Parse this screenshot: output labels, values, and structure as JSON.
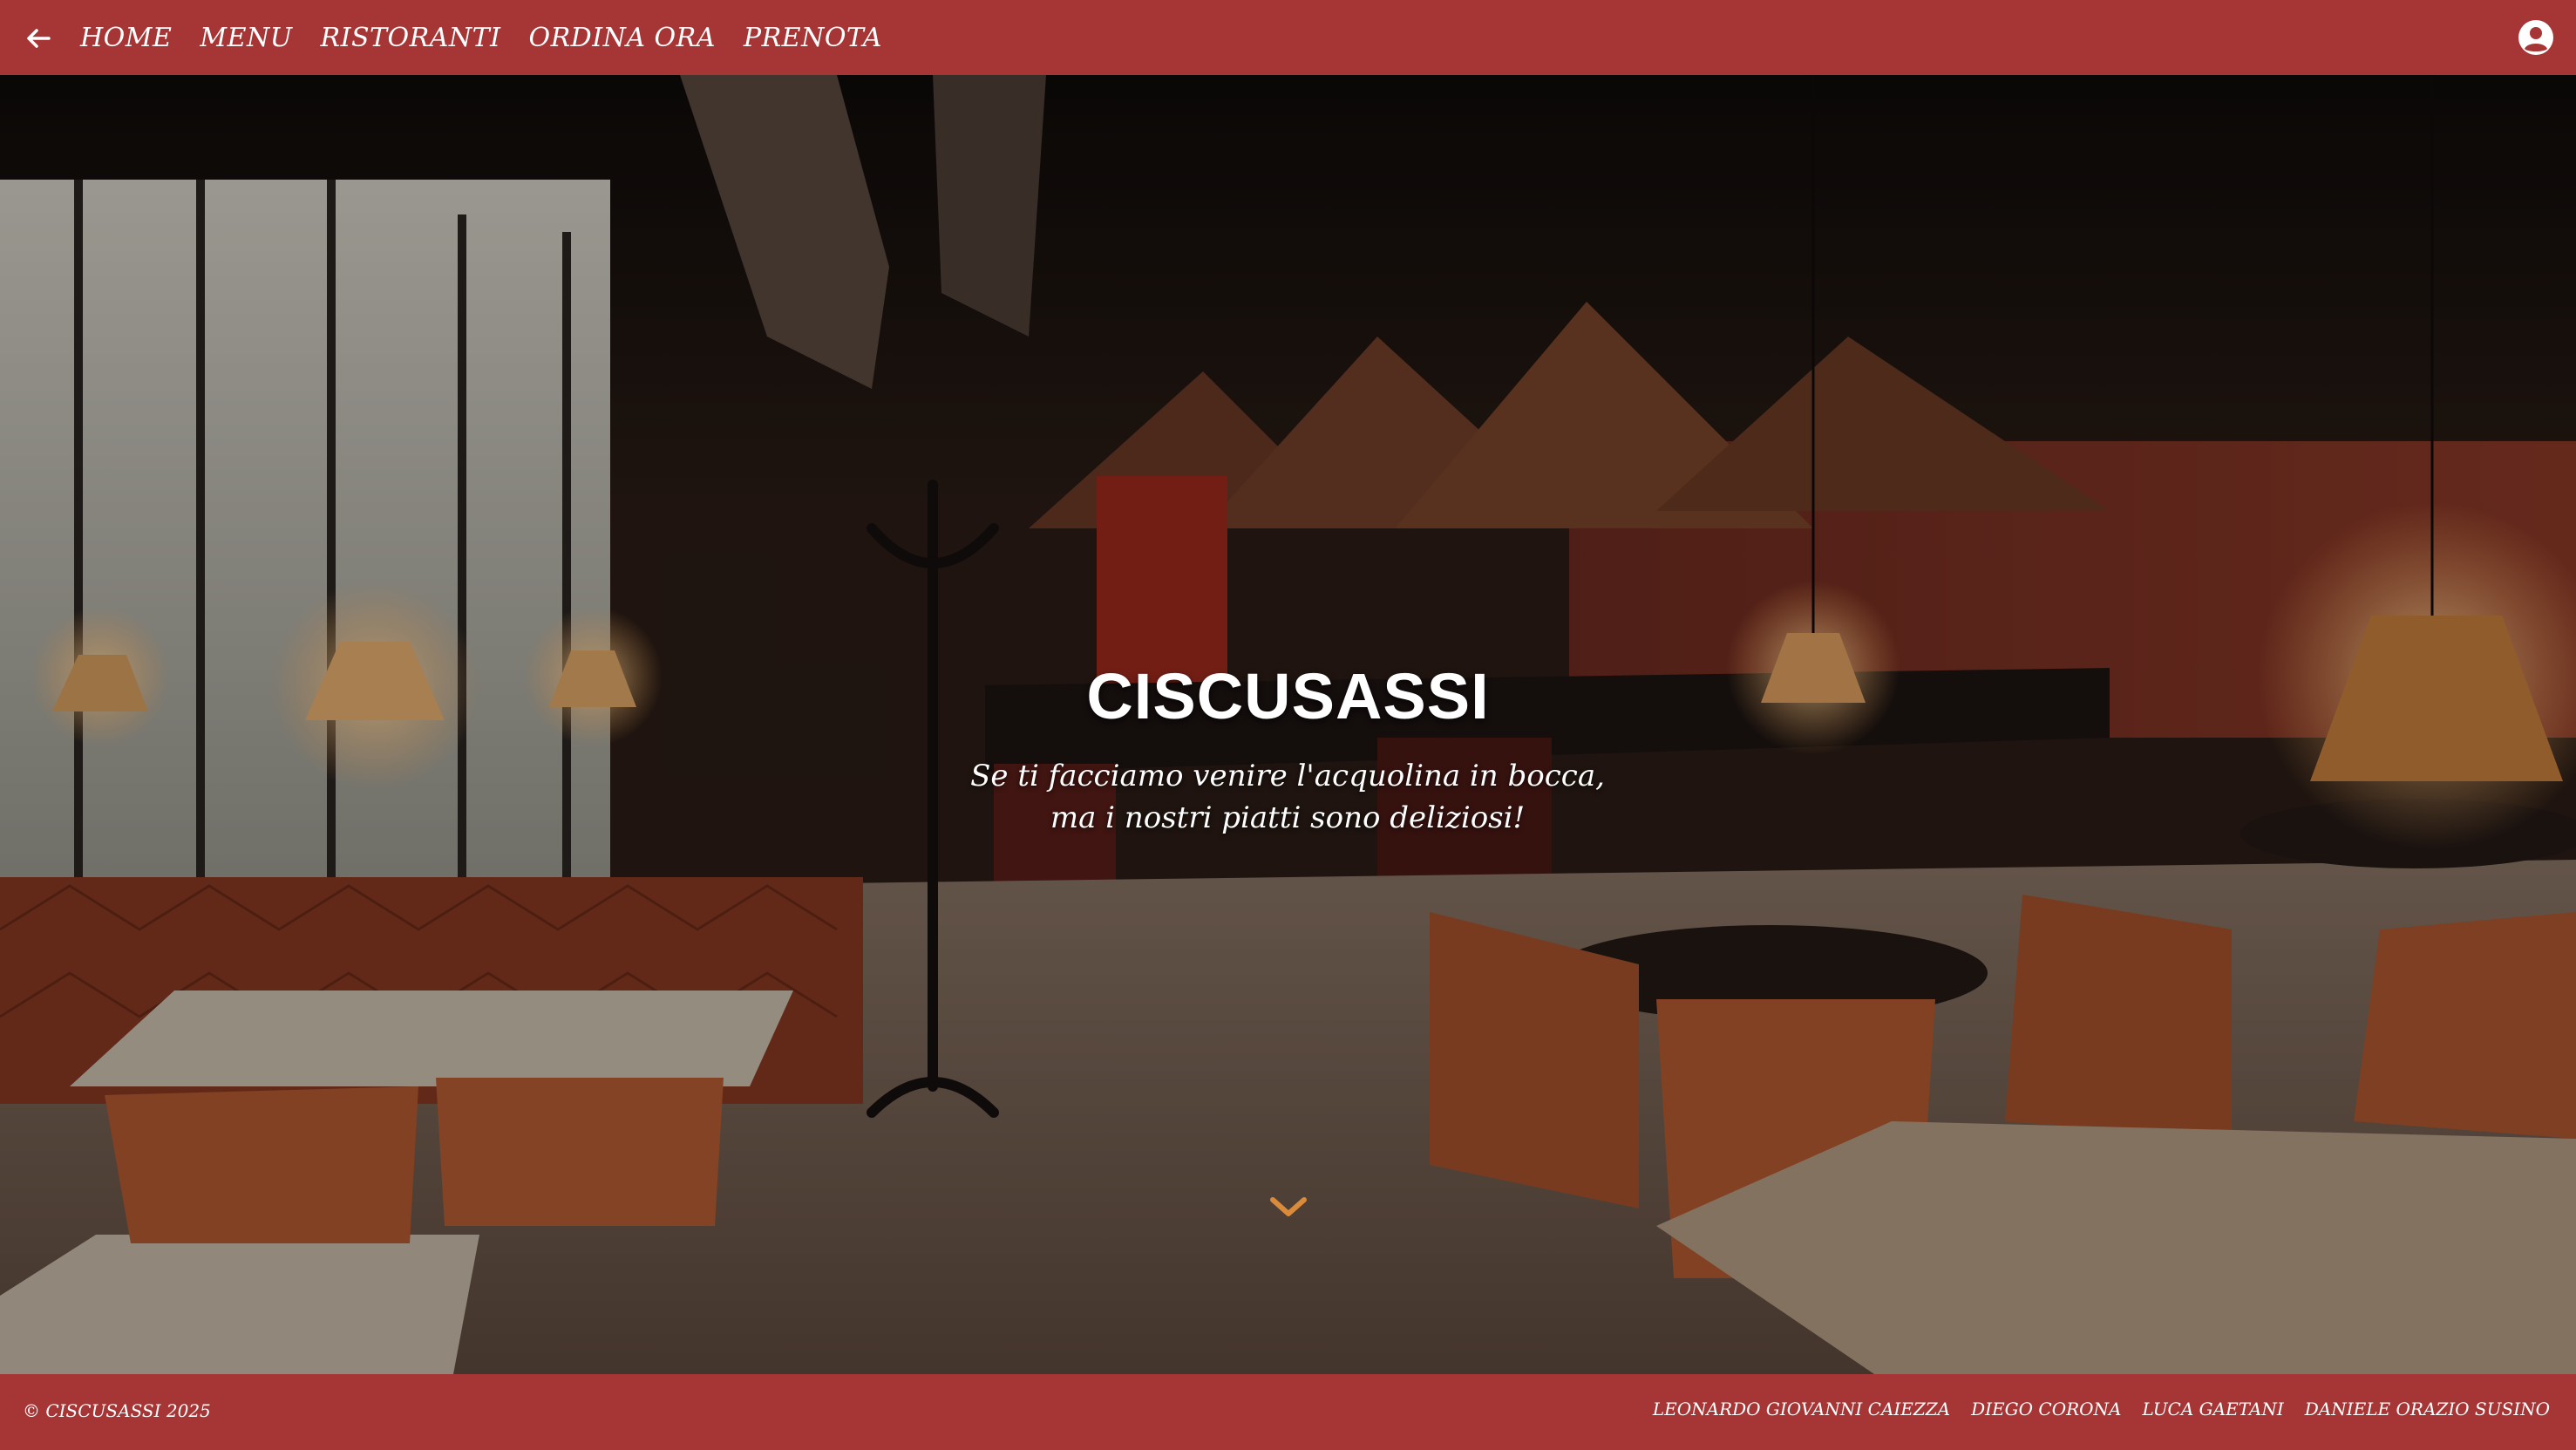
{
  "nav": {
    "back_icon": "arrow-left-icon",
    "links": [
      "HOME",
      "MENU",
      "RISTORANTI",
      "ORDINA ORA",
      "PRENOTA"
    ],
    "profile_icon": "user-circle-icon"
  },
  "hero": {
    "title": "CISCUSASSI",
    "subtitle_line1": "Se ti facciamo venire l'acquolina in bocca,",
    "subtitle_line2": "ma i nostri piatti sono deliziosi!",
    "scroll_icon": "chevron-down-icon"
  },
  "footer": {
    "copyright": "© CISCUSASSI 2025",
    "credits": [
      "LEONARDO GIOVANNI CAIEZZA",
      "DIEGO CORONA",
      "LUCA GAETANI",
      "DANIELE ORAZIO SUSINO"
    ]
  },
  "colors": {
    "brand": "#a63636",
    "text": "#ffffff",
    "scroll_accent": "#d98a3a"
  }
}
